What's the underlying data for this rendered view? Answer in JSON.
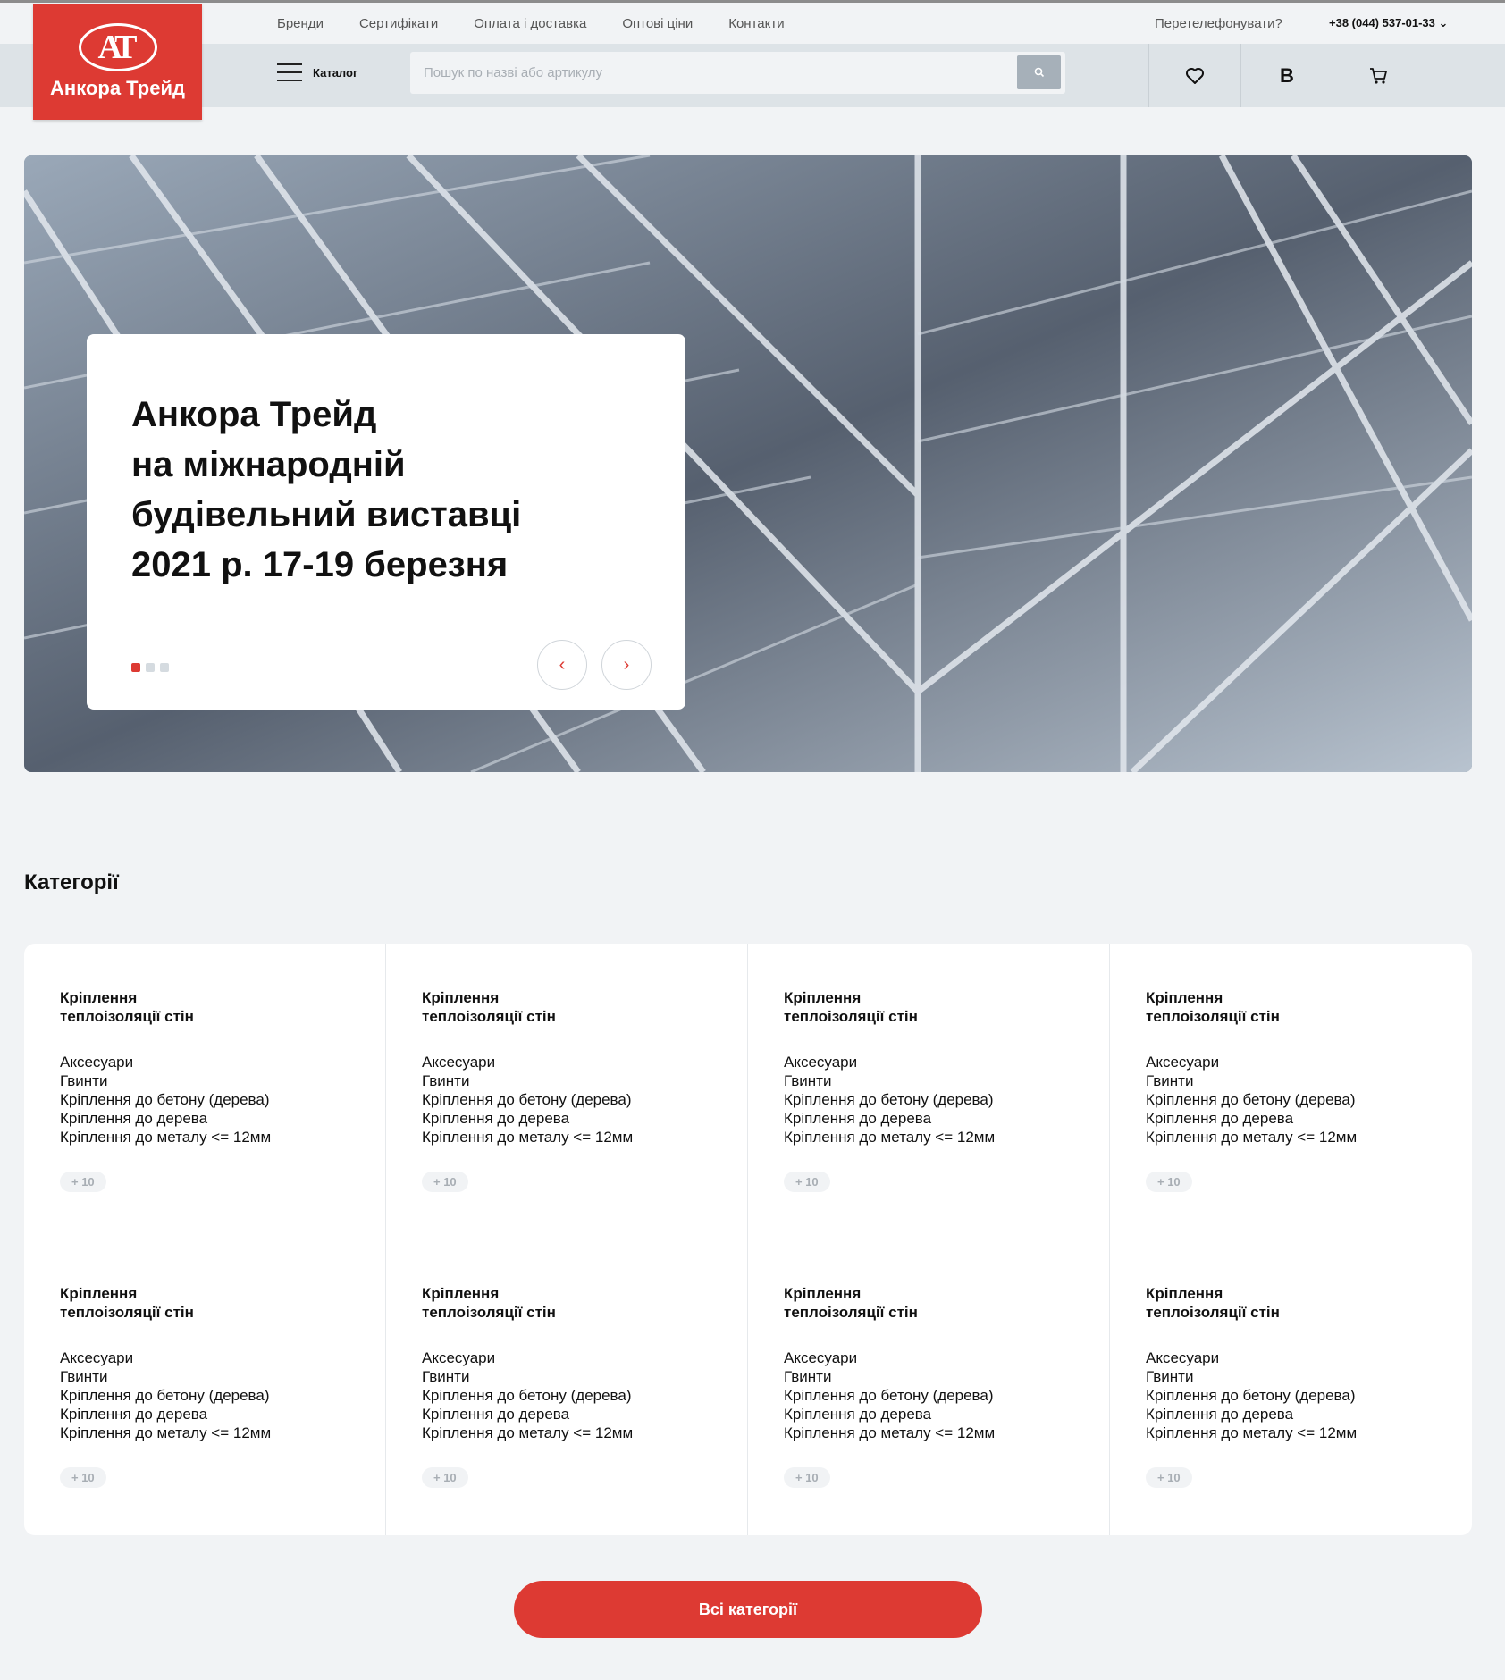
{
  "brand": {
    "name": "Анкора Трейд",
    "logo_letters": "AT",
    "accent_color": "#dd3a33"
  },
  "topnav": {
    "links": [
      "Бренди",
      "Сертифікати",
      "Оплата і доставка",
      "Оптові ціни",
      "Контакти"
    ],
    "callback": "Перетелефонувати?",
    "phone": "+38 (044) 537-01-33"
  },
  "header": {
    "catalog_label": "Каталог",
    "search_placeholder": "Пошук по назві або артикулу",
    "icons": [
      "search-icon",
      "heart-icon",
      "user-initial",
      "cart-icon"
    ],
    "user_initial": "В"
  },
  "hero": {
    "title_lines": [
      "Анкора Трейд",
      "на міжнародній",
      "будівельний виставці",
      "2021 р. 17-19 березня"
    ],
    "slides_count": 3,
    "active_slide": 1,
    "prev_icon": "‹",
    "next_icon": "›"
  },
  "categories": {
    "title": "Категорії",
    "items": [
      {
        "title": "Кріплення теплоізоляції стін",
        "links": [
          "Аксесуари",
          "Гвинти",
          "Кріплення до бетону (дерева)",
          "Кріплення до дерева",
          "Кріплення до металу <= 12мм"
        ],
        "more": "+ 10"
      },
      {
        "title": "Кріплення теплоізоляції стін",
        "links": [
          "Аксесуари",
          "Гвинти",
          "Кріплення до бетону (дерева)",
          "Кріплення до дерева",
          "Кріплення до металу <= 12мм"
        ],
        "more": "+ 10"
      },
      {
        "title": "Кріплення теплоізоляції стін",
        "links": [
          "Аксесуари",
          "Гвинти",
          "Кріплення до бетону (дерева)",
          "Кріплення до дерева",
          "Кріплення до металу <= 12мм"
        ],
        "more": "+ 10"
      },
      {
        "title": "Кріплення теплоізоляції стін",
        "links": [
          "Аксесуари",
          "Гвинти",
          "Кріплення до бетону (дерева)",
          "Кріплення до дерева",
          "Кріплення до металу <= 12мм"
        ],
        "more": "+ 10"
      },
      {
        "title": "Кріплення теплоізоляції стін",
        "links": [
          "Аксесуари",
          "Гвинти",
          "Кріплення до бетону (дерева)",
          "Кріплення до дерева",
          "Кріплення до металу <= 12мм"
        ],
        "more": "+ 10"
      },
      {
        "title": "Кріплення теплоізоляції стін",
        "links": [
          "Аксесуари",
          "Гвинти",
          "Кріплення до бетону (дерева)",
          "Кріплення до дерева",
          "Кріплення до металу <= 12мм"
        ],
        "more": "+ 10"
      },
      {
        "title": "Кріплення теплоізоляції стін",
        "links": [
          "Аксесуари",
          "Гвинти",
          "Кріплення до бетону (дерева)",
          "Кріплення до дерева",
          "Кріплення до металу <= 12мм"
        ],
        "more": "+ 10"
      },
      {
        "title": "Кріплення теплоізоляції стін",
        "links": [
          "Аксесуари",
          "Гвинти",
          "Кріплення до бетону (дерева)",
          "Кріплення до дерева",
          "Кріплення до металу <= 12мм"
        ],
        "more": "+ 10"
      }
    ],
    "all_button": "Всі категорії"
  }
}
